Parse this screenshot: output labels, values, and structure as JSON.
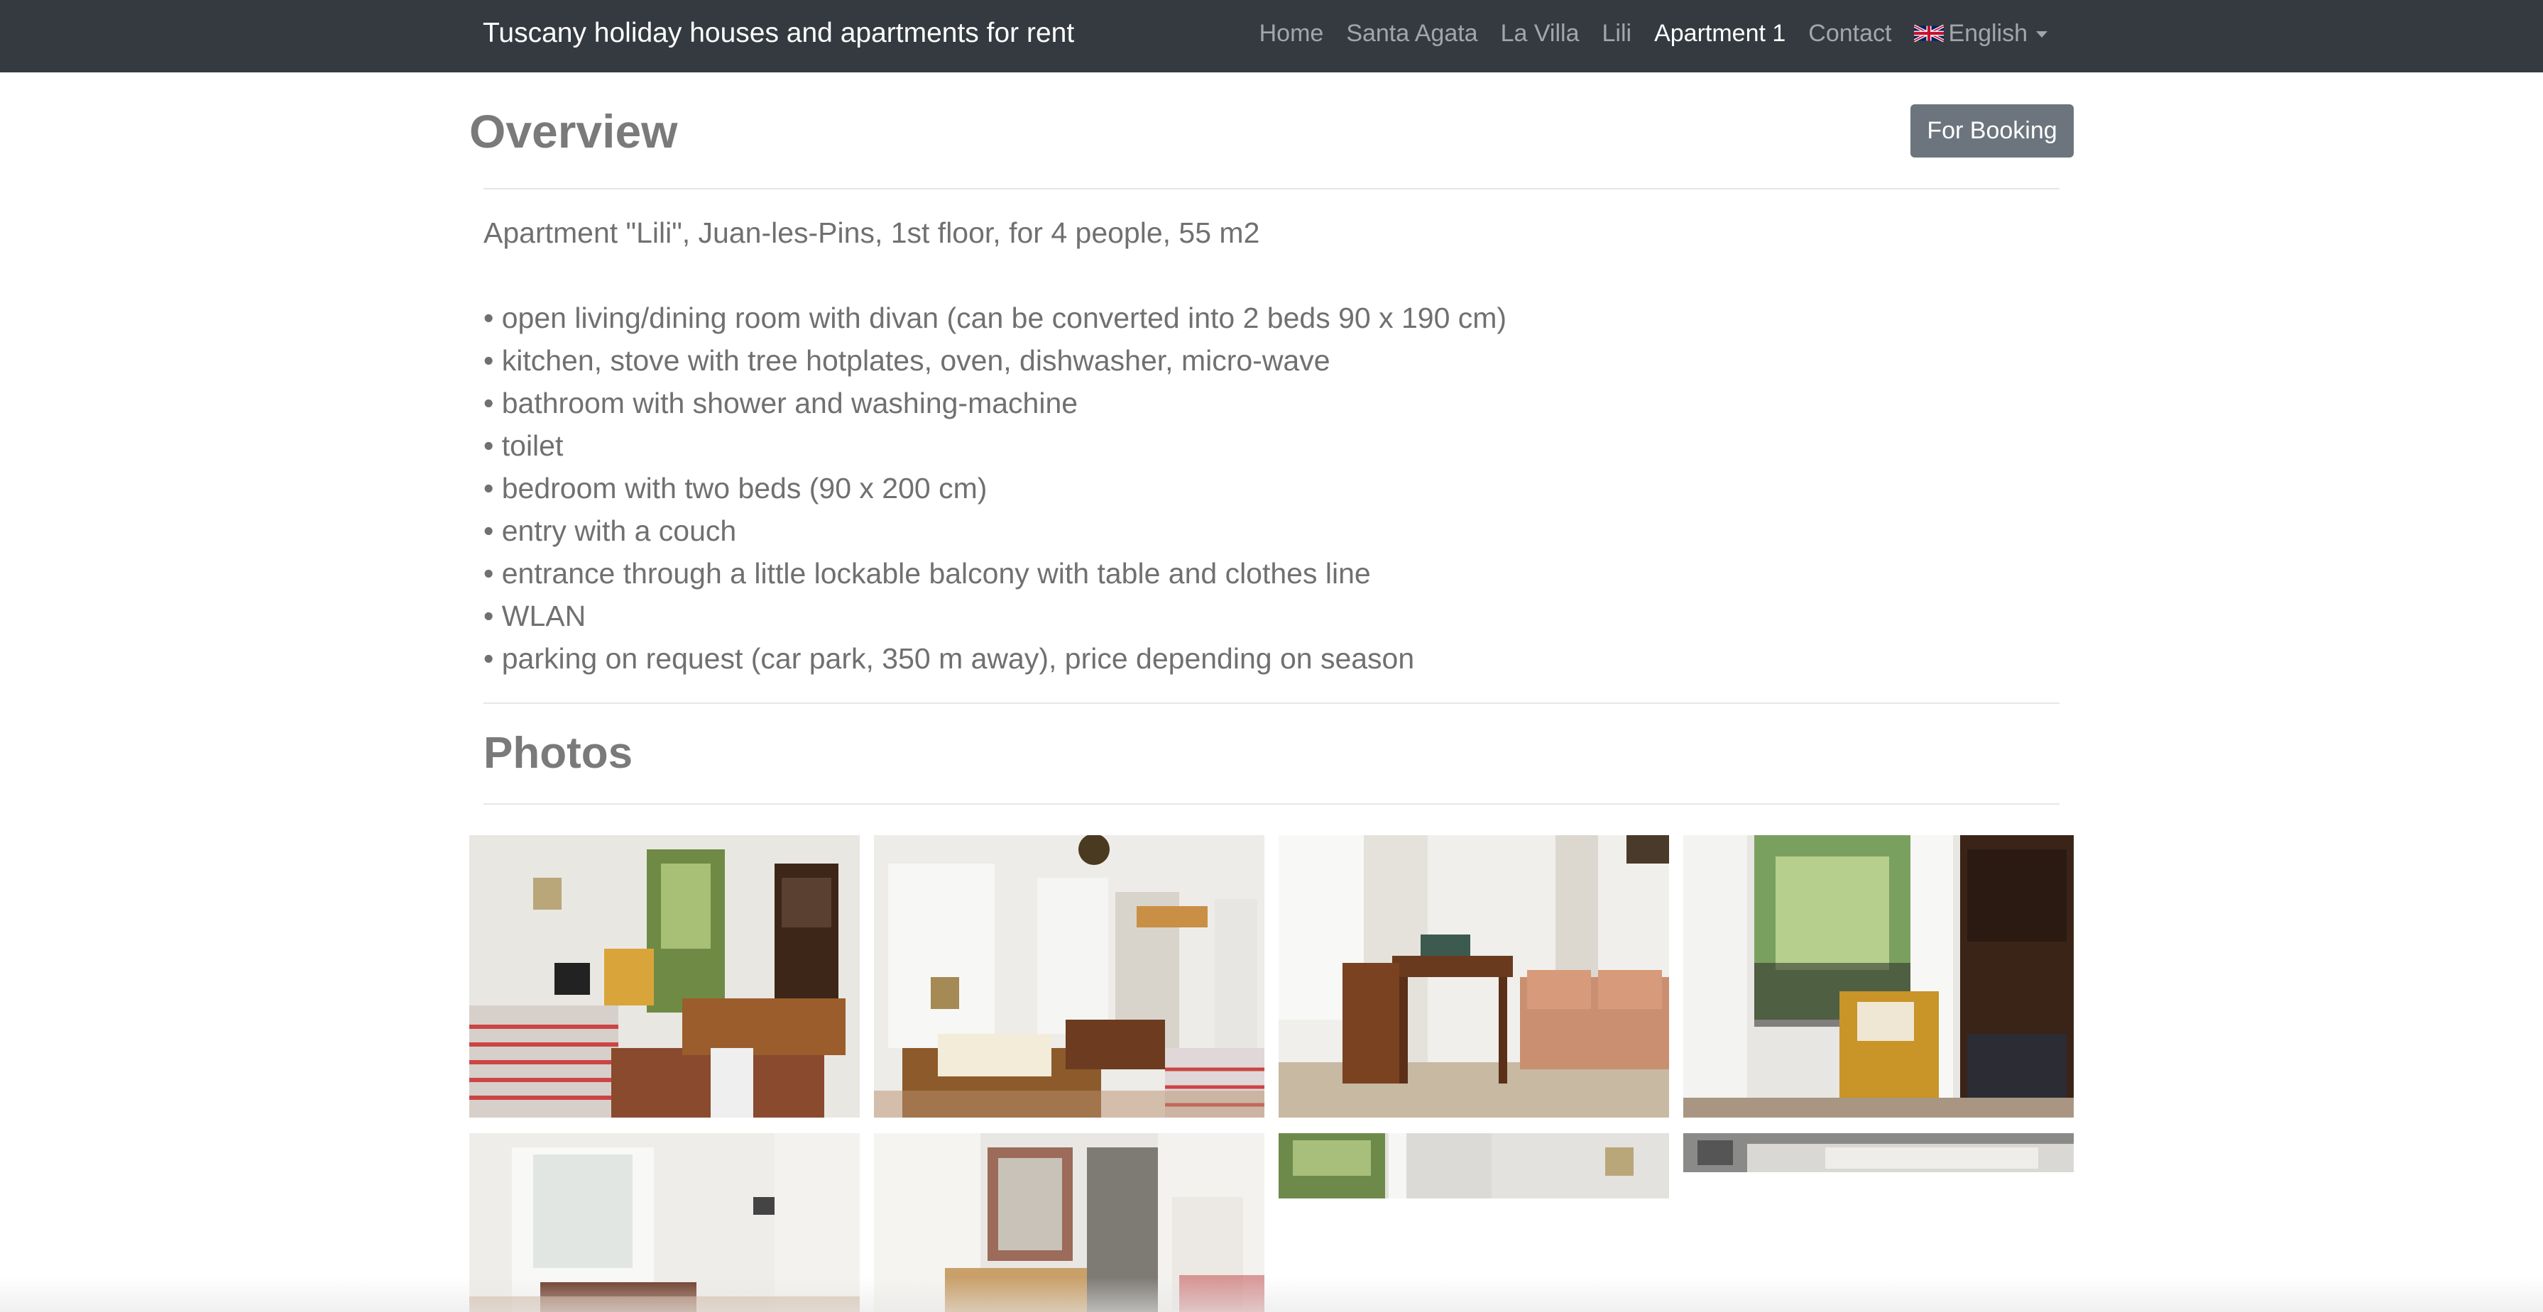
{
  "navbar": {
    "brand": "Tuscany holiday houses and apartments for rent",
    "items": [
      {
        "label": "Home",
        "active": false
      },
      {
        "label": "Santa Agata",
        "active": false
      },
      {
        "label": "La Villa",
        "active": false
      },
      {
        "label": "Lili",
        "active": false
      },
      {
        "label": "Apartment 1",
        "active": true
      },
      {
        "label": "Contact",
        "active": false
      }
    ],
    "language": {
      "label": "English",
      "icon": "uk-flag-icon"
    }
  },
  "overview": {
    "title": "Overview",
    "booking_button": "For Booking",
    "intro": "Apartment \"Lili\", Juan-les-Pins, 1st floor, for 4 people, 55 m2",
    "features": [
      "open living/dining room with divan (can be converted into 2 beds 90 x 190 cm)",
      "kitchen, stove with tree hotplates, oven, dishwasher, micro-wave",
      "bathroom with shower and washing-machine",
      "toilet",
      "bedroom with two beds (90 x 200 cm)",
      "entry with a couch",
      "entrance through a little lockable balcony with table and clothes line",
      "WLAN",
      "parking on request (car park, 350 m away), price depending on season"
    ]
  },
  "photos": {
    "title": "Photos",
    "items": [
      {
        "name": "photo-living-room-divan"
      },
      {
        "name": "photo-dining-room"
      },
      {
        "name": "photo-desk-and-sofa"
      },
      {
        "name": "photo-balcony-armchair"
      },
      {
        "name": "photo-living-room-window"
      },
      {
        "name": "photo-entry-mirror"
      },
      {
        "name": "photo-window-palm"
      },
      {
        "name": "photo-room-partial"
      }
    ]
  },
  "colors": {
    "navbar_bg": "#343a40",
    "heading": "#7a7a7a",
    "button_bg": "#6c757d"
  }
}
